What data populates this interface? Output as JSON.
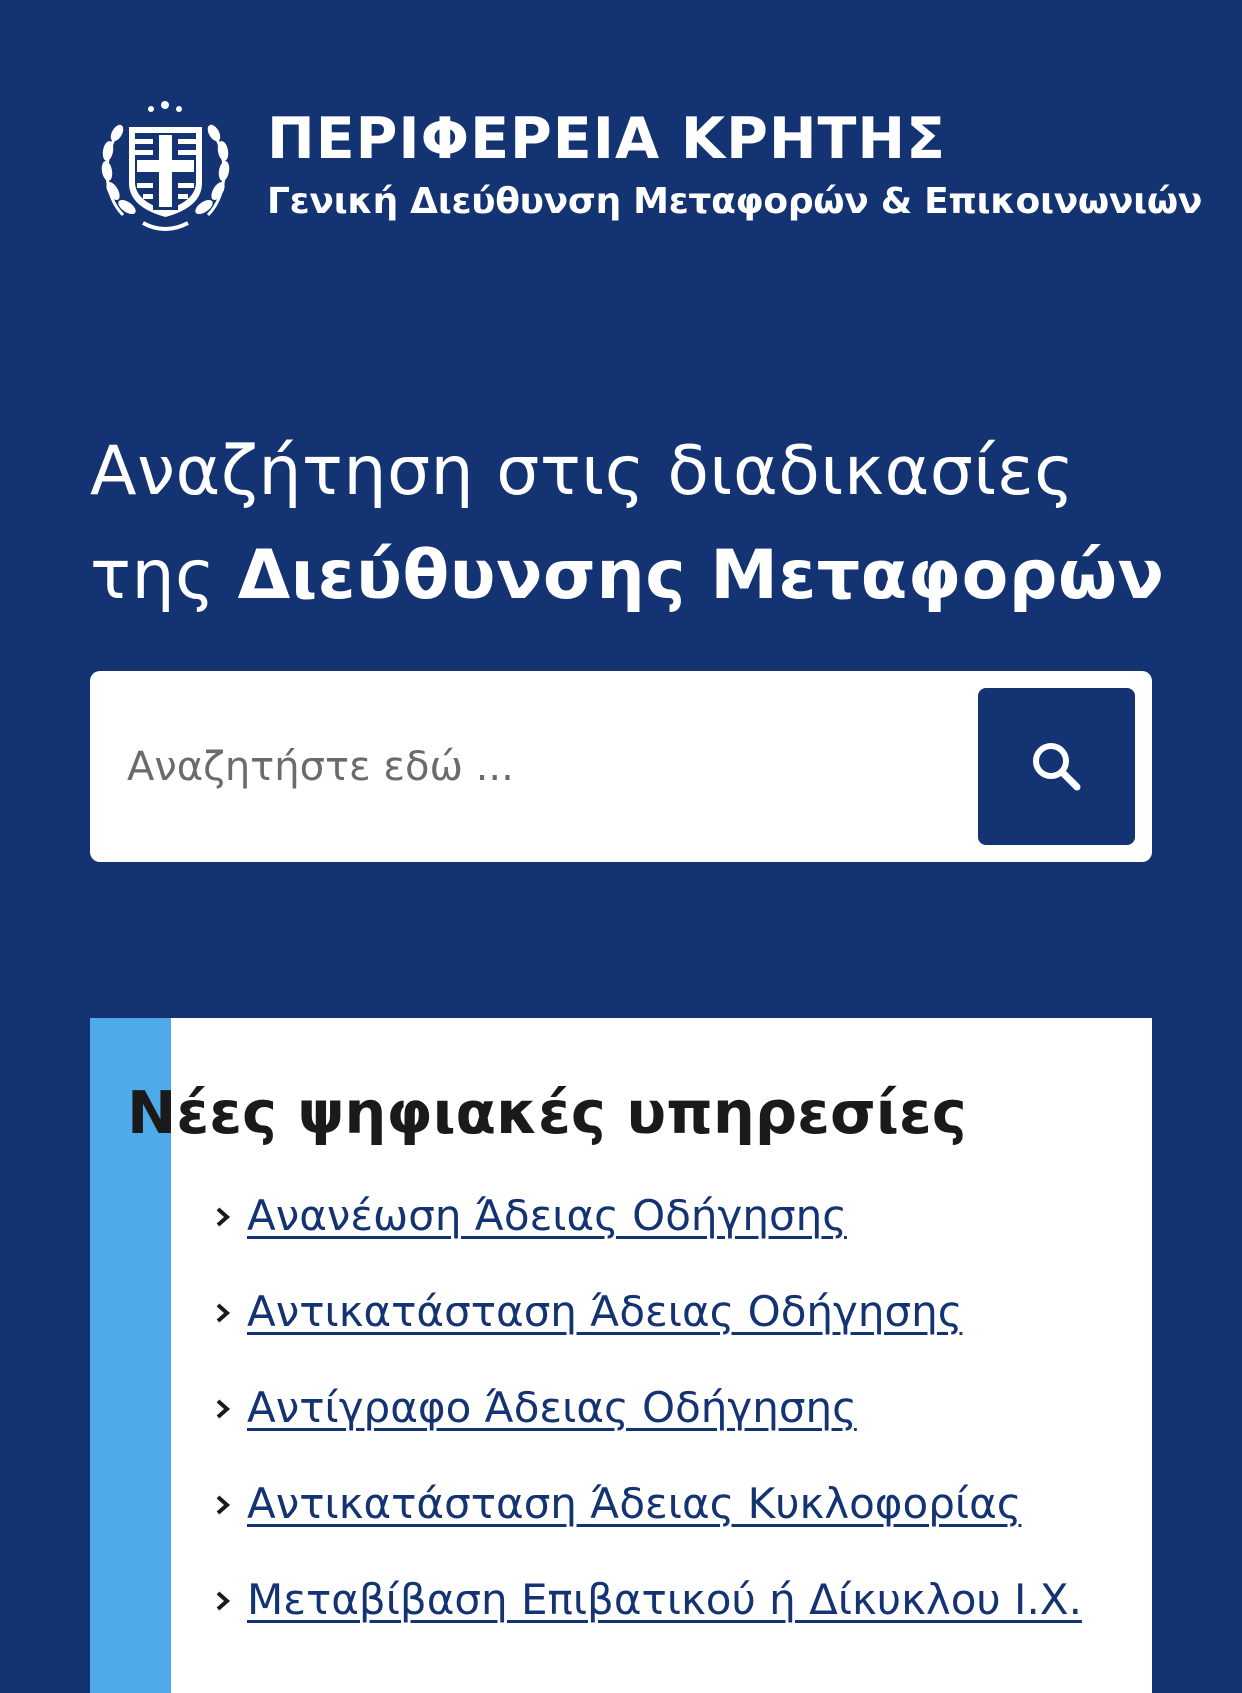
{
  "header": {
    "org_title": "ΠΕΡΙΦΕΡΕΙΑ ΚΡΗΤΗΣ",
    "org_subtitle": "Γενική Διεύθυνση Μεταφορών & Επικοινωνιών",
    "emblem_icon": "greek-coat-of-arms-icon"
  },
  "hero": {
    "line1": "Αναζήτηση στις διαδικασίες",
    "line2_prefix": "της ",
    "line2_bold": "Διεύθυνσης Μεταφορών"
  },
  "search": {
    "placeholder": "Αναζητήστε εδώ ...",
    "value": "",
    "button_icon": "search-icon"
  },
  "services": {
    "title": "Νέες ψηφιακές υπηρεσίες",
    "items": [
      {
        "label": "Ανανέωση Άδειας Οδήγησης"
      },
      {
        "label": "Αντικατάσταση Άδειας Οδήγησης"
      },
      {
        "label": "Αντίγραφο Άδειας Οδήγησης"
      },
      {
        "label": "Αντικατάσταση Άδειας Κυκλοφορίας"
      },
      {
        "label": "Μεταβίβαση Επιβατικού ή Δίκυκλου Ι.Χ."
      }
    ]
  },
  "colors": {
    "background": "#143372",
    "accent": "#4eaae8",
    "card": "#ffffff",
    "link": "#143372"
  }
}
